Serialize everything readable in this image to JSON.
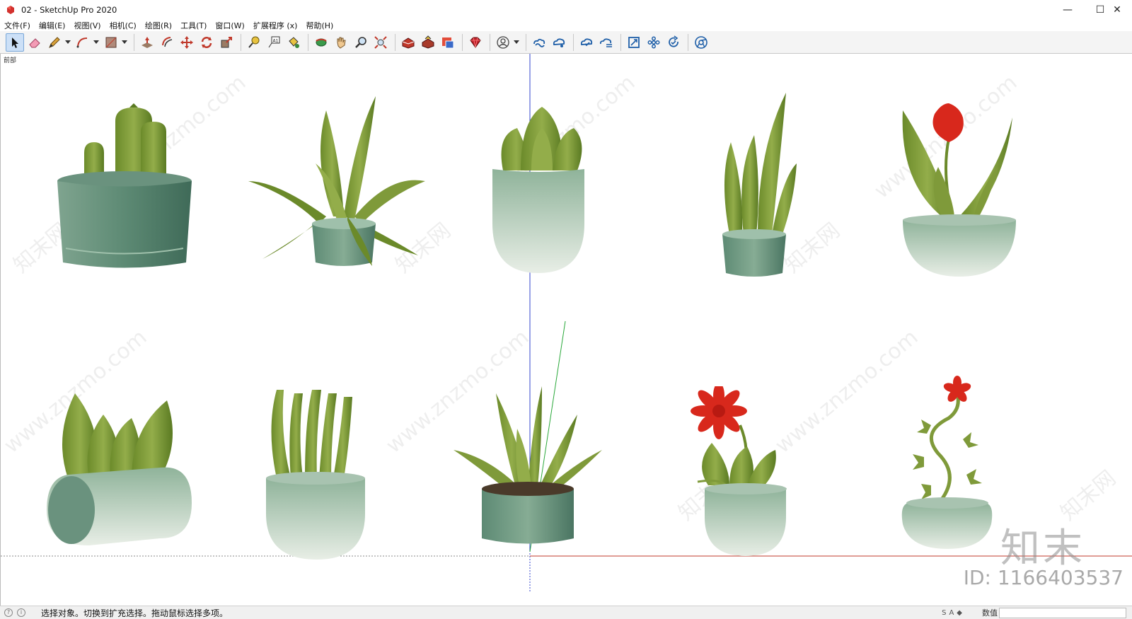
{
  "window": {
    "title": "02 - SketchUp Pro 2020",
    "controls": {
      "minimize": "—",
      "maximize": "☐",
      "close": "✕"
    }
  },
  "menu": [
    "文件(F)",
    "编辑(E)",
    "视图(V)",
    "相机(C)",
    "绘图(R)",
    "工具(T)",
    "窗口(W)",
    "扩展程序 (x)",
    "帮助(H)"
  ],
  "toolbar": {
    "tools": [
      {
        "name": "select-tool-button",
        "icon": "arrow-cursor-icon"
      },
      {
        "name": "eraser-tool-button",
        "icon": "eraser-icon"
      },
      {
        "name": "line-tool-button",
        "icon": "pencil-icon"
      },
      {
        "name": "arc-tool-button",
        "icon": "arc-icon"
      },
      {
        "name": "shape-tool-button",
        "icon": "rectangle-icon"
      },
      {
        "name": "push-pull-tool-button",
        "icon": "push-pull-icon"
      },
      {
        "name": "offset-tool-button",
        "icon": "offset-icon"
      },
      {
        "name": "move-tool-button",
        "icon": "move-icon"
      },
      {
        "name": "rotate-tool-button",
        "icon": "rotate-icon"
      },
      {
        "name": "scale-tool-button",
        "icon": "scale-icon"
      },
      {
        "name": "tape-measure-button",
        "icon": "tape-measure-icon"
      },
      {
        "name": "text-tool-button",
        "icon": "text-icon"
      },
      {
        "name": "paint-bucket-button",
        "icon": "paint-bucket-icon"
      },
      {
        "name": "orbit-tool-button",
        "icon": "orbit-icon"
      },
      {
        "name": "pan-tool-button",
        "icon": "hand-icon"
      },
      {
        "name": "zoom-tool-button",
        "icon": "magnifier-icon"
      },
      {
        "name": "zoom-extents-button",
        "icon": "zoom-extents-icon"
      },
      {
        "name": "warehouse-button",
        "icon": "warehouse-icon"
      },
      {
        "name": "share-model-button",
        "icon": "share-model-icon"
      },
      {
        "name": "send-to-layout-button",
        "icon": "layout-icon"
      },
      {
        "name": "extension-warehouse-button",
        "icon": "ruby-gem-icon"
      },
      {
        "name": "account-button",
        "icon": "user-icon"
      },
      {
        "name": "trimble-connect-button",
        "icon": "cloud-link-icon"
      },
      {
        "name": "cloud-share-button",
        "icon": "cloud-share-icon"
      },
      {
        "name": "cloud-sync-button",
        "icon": "cloud-check-icon"
      },
      {
        "name": "cloud-list-button",
        "icon": "cloud-list-icon"
      },
      {
        "name": "frame-button",
        "icon": "frame-icon"
      },
      {
        "name": "flower-button",
        "icon": "flower-icon"
      },
      {
        "name": "refresh-button",
        "icon": "refresh-check-icon"
      },
      {
        "name": "chrome-button",
        "icon": "chrome-icon"
      }
    ]
  },
  "viewport": {
    "scene_label": "前部",
    "watermark": "www.znzmo.com",
    "watermark_cn": "知末网",
    "brand_mark": "知末",
    "id_text": "ID: 1166403537",
    "colors": {
      "pot": "#8fb39a",
      "leaf": "#7f9a3a",
      "flower": "#d8281c"
    },
    "plants": [
      "cactus-pot",
      "agave-pot",
      "succulent-capsule-pot",
      "snake-plant-pot",
      "tulip-bowl",
      "leafy-capsule-planter",
      "finger-succulent-pot",
      "aloe-pot",
      "red-daisy-pot",
      "vine-flower-bowl"
    ]
  },
  "status": {
    "text": "选择对象。切换到扩充选择。拖动鼠标选择多项。",
    "measurements_label": "数值",
    "measurements_value": ""
  }
}
